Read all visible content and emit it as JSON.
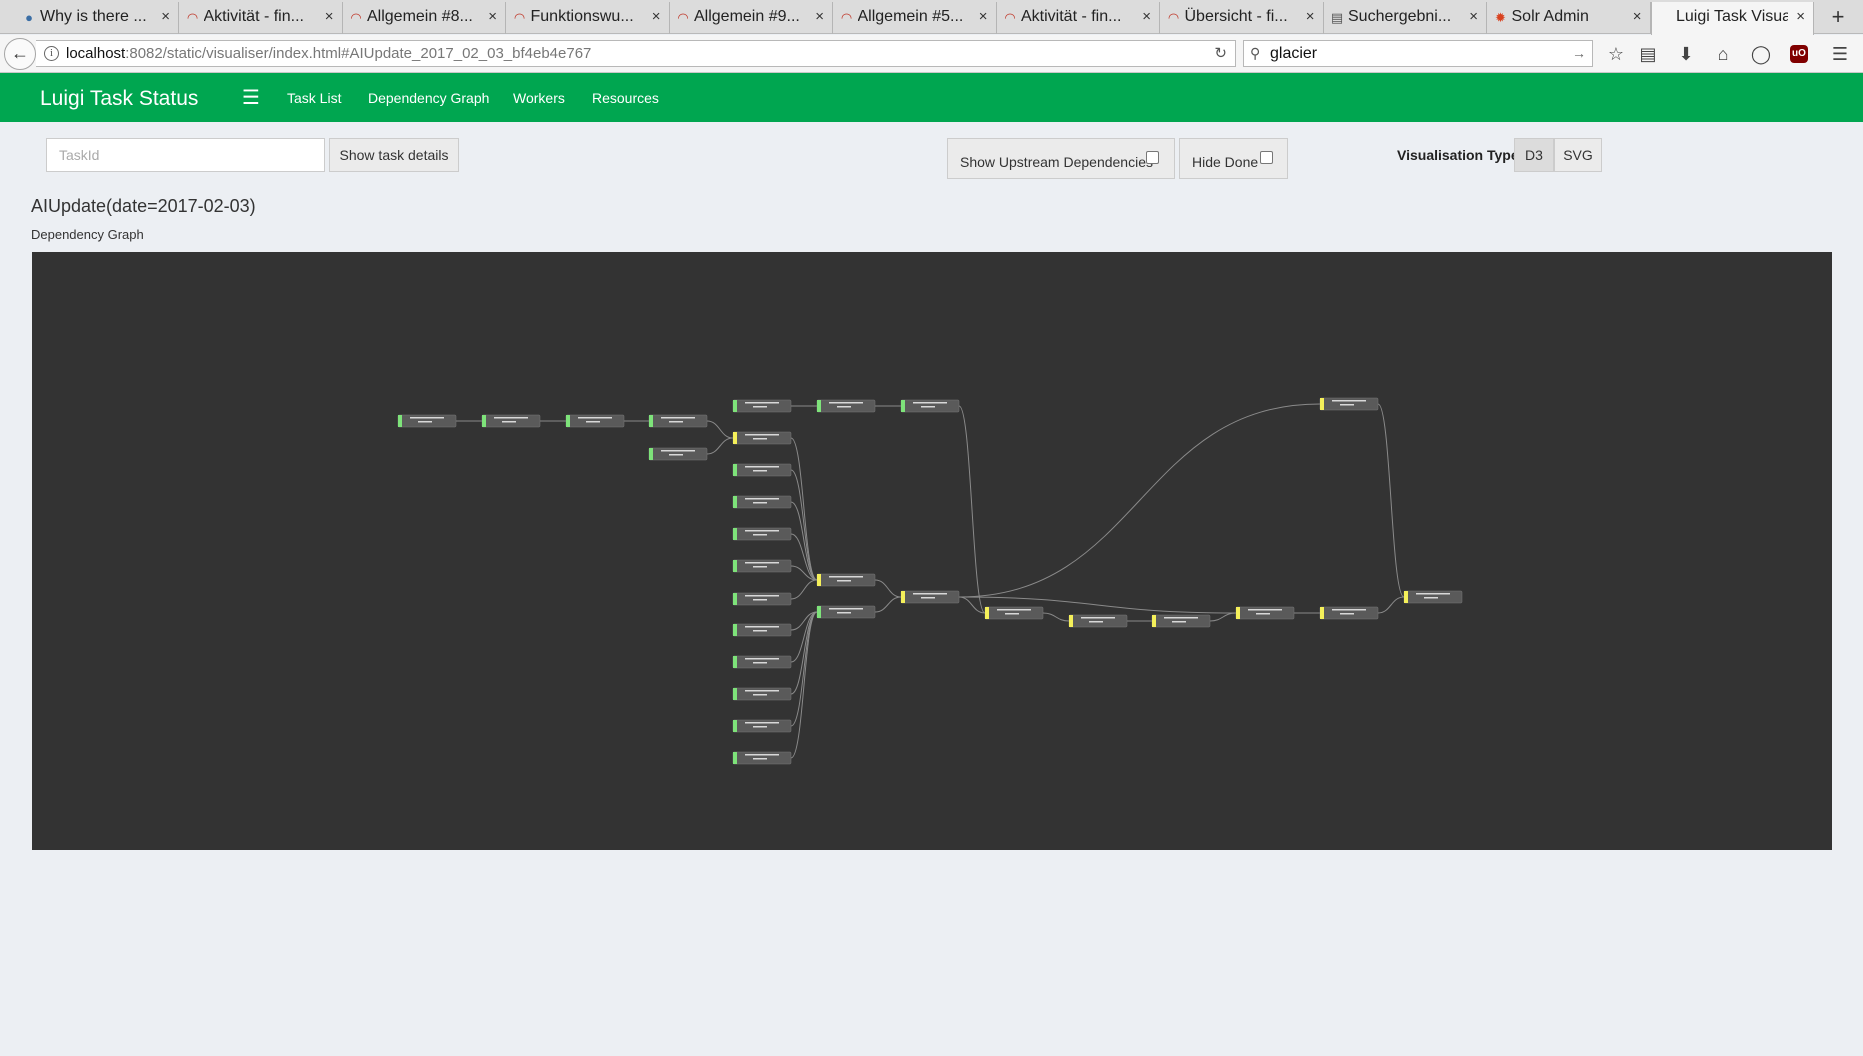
{
  "browser": {
    "tabs": [
      {
        "title": "Why is there ...",
        "favicon": "speech-bubble-icon"
      },
      {
        "title": "Aktivität - fin...",
        "favicon": "atlassian-icon"
      },
      {
        "title": "Allgemein #8...",
        "favicon": "atlassian-icon"
      },
      {
        "title": "Funktionswu...",
        "favicon": "atlassian-icon"
      },
      {
        "title": "Allgemein #9...",
        "favicon": "atlassian-icon"
      },
      {
        "title": "Allgemein #5...",
        "favicon": "atlassian-icon"
      },
      {
        "title": "Aktivität - fin...",
        "favicon": "atlassian-icon"
      },
      {
        "title": "Übersicht - fi...",
        "favicon": "atlassian-icon"
      },
      {
        "title": "Suchergebni...",
        "favicon": "document-icon"
      },
      {
        "title": "Solr Admin",
        "favicon": "solr-icon"
      },
      {
        "title": "Luigi Task Visua...",
        "favicon": "none"
      }
    ],
    "url_host": "localhost",
    "url_rest": ":8082/static/visualiser/index.html#AIUpdate_2017_02_03_bf4eb4e767",
    "search_value": "glacier"
  },
  "app": {
    "brand": "Luigi Task Status",
    "nav": [
      "Task List",
      "Dependency Graph",
      "Workers",
      "Resources"
    ],
    "taskid_placeholder": "TaskId",
    "show_details_label": "Show task details",
    "upstream_label": "Show Upstream Dependencies",
    "hide_done_label": "Hide Done",
    "vis_type_label": "Visualisation Type",
    "vis_options": [
      "D3",
      "SVG"
    ],
    "vis_selected": "D3",
    "task_title": "AIUpdate(date=2017-02-03)",
    "graph_label": "Dependency Graph"
  },
  "colors": {
    "app_green": "#00a650",
    "graph_bg": "#333333",
    "done": "#7ee37a",
    "pending": "#f5f05a",
    "node": "#5a5a5a",
    "edge": "#8a8a8a"
  },
  "graph": {
    "nodes": [
      {
        "id": 0,
        "status": "done"
      },
      {
        "id": 1,
        "status": "done"
      },
      {
        "id": 2,
        "status": "done"
      },
      {
        "id": 3,
        "status": "done"
      },
      {
        "id": 4,
        "status": "done"
      },
      {
        "id": 5,
        "status": "done"
      },
      {
        "id": 6,
        "status": "done"
      },
      {
        "id": 7,
        "status": "done"
      },
      {
        "id": 8,
        "status": "pending"
      },
      {
        "id": 9,
        "status": "done"
      },
      {
        "id": 10,
        "status": "done"
      },
      {
        "id": 11,
        "status": "done"
      },
      {
        "id": 12,
        "status": "done"
      },
      {
        "id": 13,
        "status": "done"
      },
      {
        "id": 14,
        "status": "done"
      },
      {
        "id": 15,
        "status": "done"
      },
      {
        "id": 16,
        "status": "done"
      },
      {
        "id": 17,
        "status": "done"
      },
      {
        "id": 18,
        "status": "done"
      },
      {
        "id": 19,
        "status": "pending"
      },
      {
        "id": 20,
        "status": "done"
      },
      {
        "id": 21,
        "status": "pending"
      },
      {
        "id": 22,
        "status": "pending"
      },
      {
        "id": 23,
        "status": "pending"
      },
      {
        "id": 24,
        "status": "pending"
      },
      {
        "id": 25,
        "status": "pending"
      },
      {
        "id": 26,
        "status": "pending"
      },
      {
        "id": 27,
        "status": "pending"
      },
      {
        "id": 28,
        "status": "pending"
      }
    ],
    "edges": [
      [
        0,
        1
      ],
      [
        1,
        2
      ],
      [
        2,
        3
      ],
      [
        3,
        8
      ],
      [
        4,
        8
      ],
      [
        5,
        6
      ],
      [
        6,
        7
      ],
      [
        8,
        19
      ],
      [
        9,
        19
      ],
      [
        10,
        19
      ],
      [
        11,
        19
      ],
      [
        12,
        19
      ],
      [
        13,
        19
      ],
      [
        14,
        20
      ],
      [
        15,
        20
      ],
      [
        16,
        20
      ],
      [
        17,
        20
      ],
      [
        18,
        20
      ],
      [
        19,
        21
      ],
      [
        20,
        21
      ],
      [
        21,
        22
      ],
      [
        7,
        22
      ],
      [
        22,
        23
      ],
      [
        23,
        24
      ],
      [
        24,
        25
      ],
      [
        21,
        25
      ],
      [
        25,
        26
      ],
      [
        26,
        28
      ],
      [
        27,
        28
      ],
      [
        21,
        27
      ]
    ]
  }
}
